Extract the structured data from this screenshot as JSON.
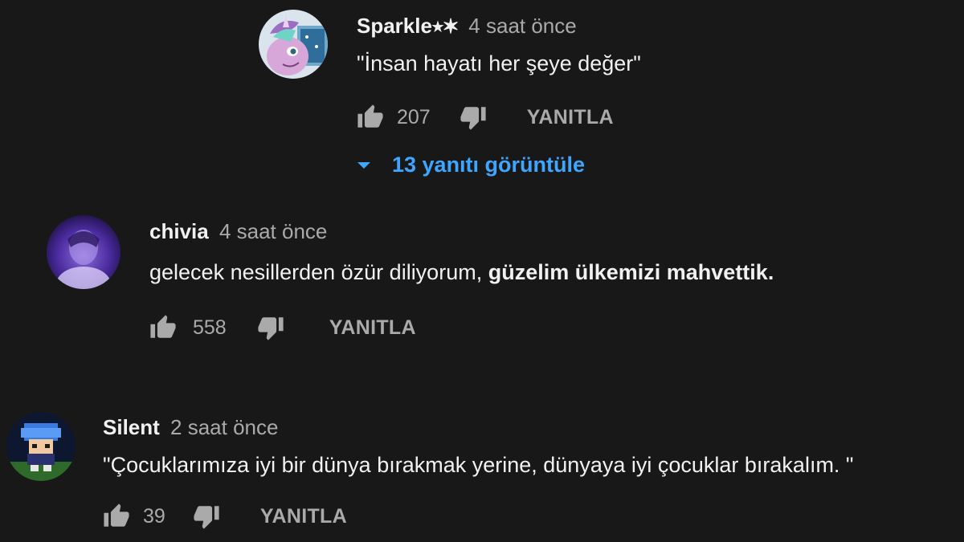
{
  "comments": [
    {
      "author": "Sparkle⭑✶",
      "time": "4 saat önce",
      "text": "\"İnsan hayatı her şeye değer\"",
      "likes": "207",
      "reply_label": "YANITLA",
      "replies_label": "13 yanıtı görüntüle",
      "avatar_icon": "pony-avatar"
    },
    {
      "author": "chivia",
      "time": "4 saat önce",
      "text_plain": "gelecek nesillerden özür diliyorum, ",
      "text_bold": "güzelim ülkemizi mahvettik.",
      "likes": "558",
      "reply_label": "YANITLA",
      "avatar_icon": "purple-avatar"
    },
    {
      "author": "Silent",
      "time": "2 saat önce",
      "text": "\"Çocuklarımıza iyi bir dünya bırakmak yerine, dünyaya iyi çocuklar bırakalım. \"",
      "likes": "39",
      "reply_label": "YANITLA",
      "avatar_icon": "pixel-character-avatar"
    }
  ],
  "colors": {
    "background": "#181818",
    "primary_text": "#f1f1f1",
    "secondary_text": "#aaaaaa",
    "link_blue": "#3ea6ff"
  }
}
